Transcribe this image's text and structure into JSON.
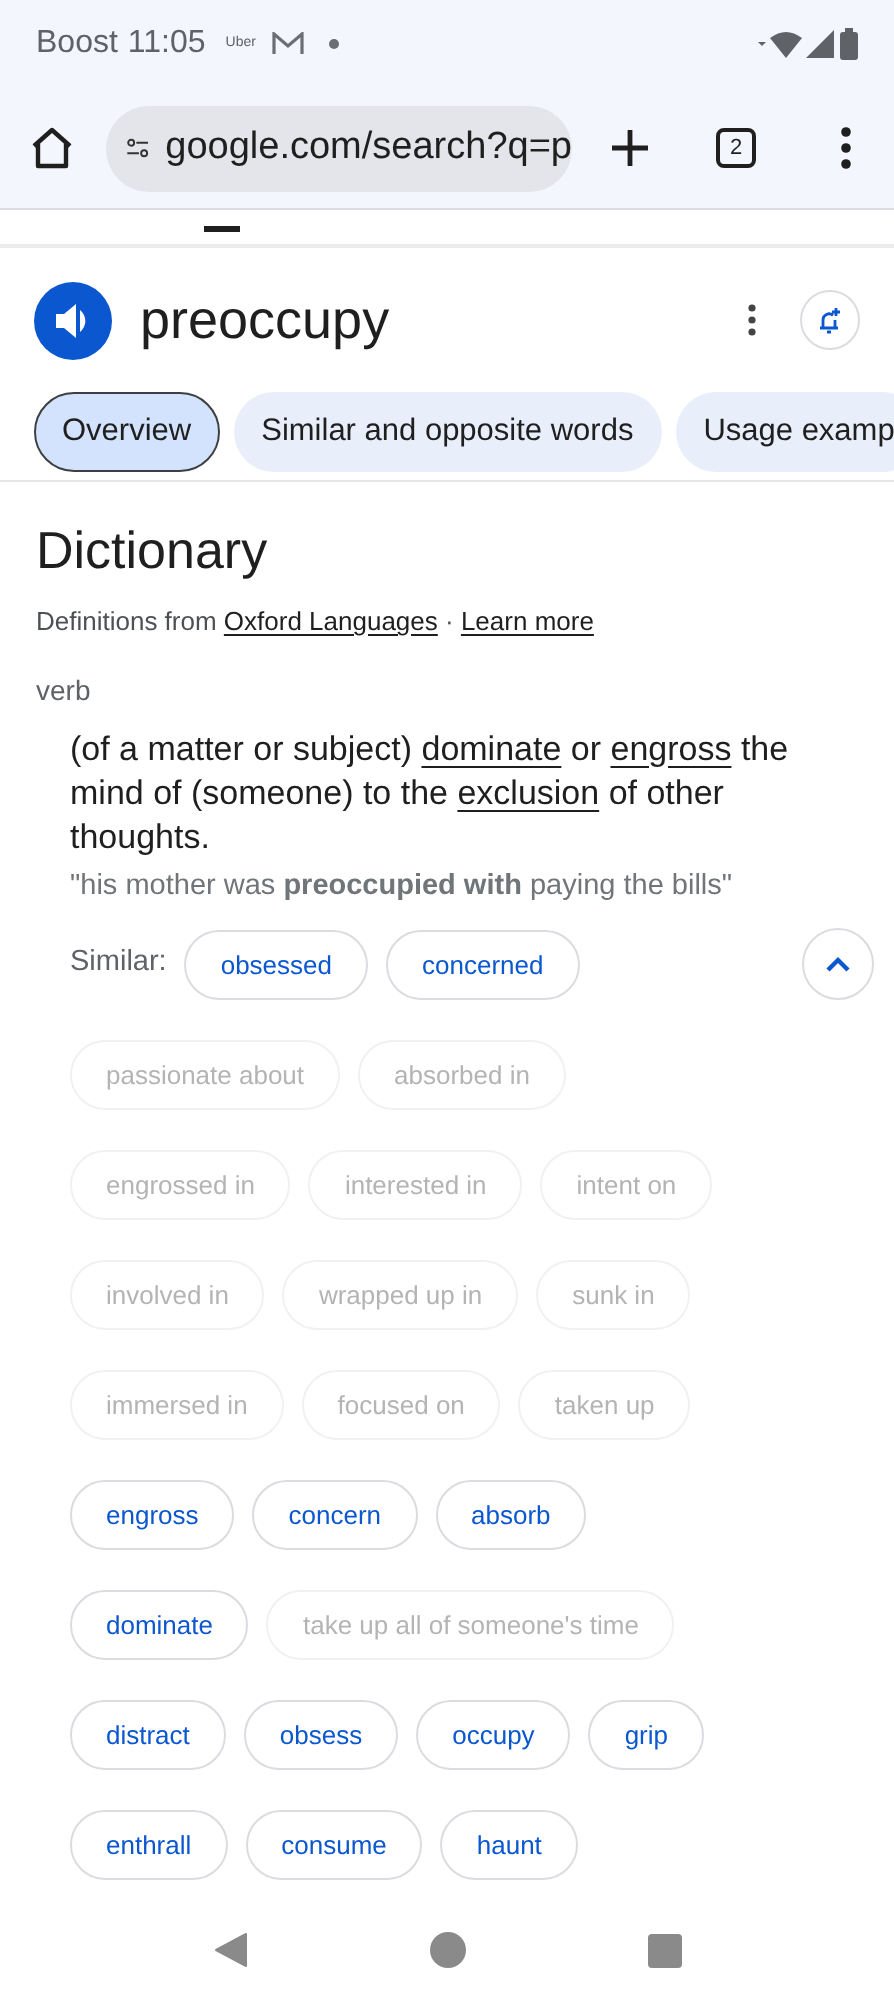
{
  "status_bar": {
    "carrier": "Boost",
    "time": "11:05",
    "notification_text": "Uber"
  },
  "browser": {
    "url": "google.com/search?q=p",
    "tab_count": "2"
  },
  "word": {
    "text": "preoccupy"
  },
  "tabs": [
    {
      "label": "Overview",
      "selected": true
    },
    {
      "label": "Similar and opposite words",
      "selected": false
    },
    {
      "label": "Usage examp",
      "selected": false
    }
  ],
  "dictionary": {
    "title": "Dictionary",
    "source": [
      {
        "text": "Definitions from ",
        "link": false
      },
      {
        "text": "Oxford Languages",
        "link": true
      },
      {
        "text": " · ",
        "link": false
      },
      {
        "text": "Learn more",
        "link": true
      }
    ],
    "part_of_speech": "verb",
    "definition": [
      {
        "text": "(of a matter or subject) ",
        "link": false
      },
      {
        "text": "dominate",
        "link": true
      },
      {
        "text": " or ",
        "link": false
      },
      {
        "text": "engross",
        "link": true
      },
      {
        "text": " the mind of (someone) to the ",
        "link": false
      },
      {
        "text": "exclusion",
        "link": true
      },
      {
        "text": " of other thoughts.",
        "link": false
      }
    ],
    "example": "\"his mother was **preoccupied with** paying the bills\"",
    "similar_label": "Similar:",
    "expanded": true,
    "similar_first_row": [
      {
        "text": "obsessed",
        "disabled": false
      },
      {
        "text": "concerned",
        "disabled": false
      }
    ],
    "similar_rows": [
      [
        {
          "text": "passionate about",
          "disabled": true
        },
        {
          "text": "absorbed in",
          "disabled": true
        }
      ],
      [
        {
          "text": "engrossed in",
          "disabled": true
        },
        {
          "text": "interested in",
          "disabled": true
        },
        {
          "text": "intent on",
          "disabled": true
        }
      ],
      [
        {
          "text": "involved in",
          "disabled": true
        },
        {
          "text": "wrapped up in",
          "disabled": true
        },
        {
          "text": "sunk in",
          "disabled": true
        }
      ],
      [
        {
          "text": "immersed in",
          "disabled": true
        },
        {
          "text": "focused on",
          "disabled": true
        },
        {
          "text": "taken up",
          "disabled": true
        }
      ],
      [
        {
          "text": "engross",
          "disabled": false
        },
        {
          "text": "concern",
          "disabled": false
        },
        {
          "text": "absorb",
          "disabled": false
        }
      ],
      [
        {
          "text": "dominate",
          "disabled": false
        },
        {
          "text": "take up all of someone's time",
          "disabled": true
        }
      ],
      [
        {
          "text": "distract",
          "disabled": false
        },
        {
          "text": "obsess",
          "disabled": false
        },
        {
          "text": "occupy",
          "disabled": false
        },
        {
          "text": "grip",
          "disabled": false
        }
      ],
      [
        {
          "text": "enthrall",
          "disabled": false
        },
        {
          "text": "consume",
          "disabled": false
        },
        {
          "text": "haunt",
          "disabled": false
        }
      ]
    ]
  }
}
